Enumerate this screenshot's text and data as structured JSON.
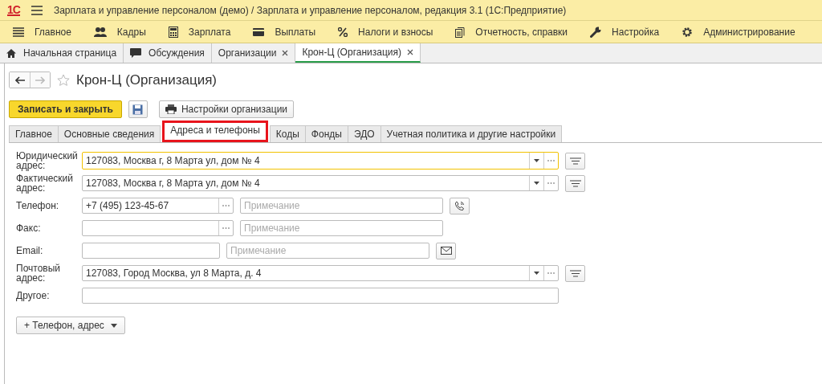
{
  "window": {
    "logo": "1С",
    "title": "Зарплата и управление персоналом (демо) / Зарплата и управление персоналом, редакция 3.1  (1С:Предприятие)"
  },
  "main_menu": [
    "Главное",
    "Кадры",
    "Зарплата",
    "Выплаты",
    "Налоги и взносы",
    "Отчетность, справки",
    "Настройка",
    "Администрирование"
  ],
  "open_tabs": [
    {
      "label": "Начальная страница",
      "selected": false,
      "closable": false,
      "kind": "home"
    },
    {
      "label": "Обсуждения",
      "selected": false,
      "closable": false,
      "kind": "chat"
    },
    {
      "label": "Организации",
      "selected": false,
      "closable": true,
      "kind": "plain"
    },
    {
      "label": "Крон-Ц (Организация)",
      "selected": true,
      "closable": true,
      "kind": "plain"
    }
  ],
  "form": {
    "title": "Крон-Ц (Организация)",
    "favorite": false,
    "buttons": {
      "primary": "Записать и закрыть",
      "settings": "Настройки организации"
    },
    "tabs": [
      {
        "label": "Главное",
        "selected": false,
        "highlighted": false
      },
      {
        "label": "Основные сведения",
        "selected": false,
        "highlighted": false
      },
      {
        "label": "Адреса и телефоны",
        "selected": true,
        "highlighted": true
      },
      {
        "label": "Коды",
        "selected": false,
        "highlighted": false
      },
      {
        "label": "Фонды",
        "selected": false,
        "highlighted": false
      },
      {
        "label": "ЭДО",
        "selected": false,
        "highlighted": false
      },
      {
        "label": "Учетная политика и другие настройки",
        "selected": false,
        "highlighted": false
      }
    ],
    "rows": [
      {
        "kind": "address",
        "label": "Юридический адрес:",
        "value": "127083, Москва г, 8 Марта ул, дом № 4",
        "focused": true
      },
      {
        "kind": "address",
        "label": "Фактический адрес:",
        "value": "127083, Москва г, 8 Марта ул, дом № 4",
        "focused": false
      },
      {
        "kind": "phone",
        "label": "Телефон:",
        "value": "+7 (495) 123-45-67",
        "placeholder": "Примечание"
      },
      {
        "kind": "fax",
        "label": "Факс:",
        "placeholder": "Примечание"
      },
      {
        "kind": "email",
        "label": "Email:",
        "placeholder": "Примечание"
      },
      {
        "kind": "address",
        "label": "Почтовый адрес:",
        "value": "127083, Город Москва, ул 8 Марта, д. 4",
        "focused": false
      },
      {
        "kind": "other",
        "label": "Другое:"
      }
    ],
    "add_button": "+ Телефон, адрес"
  }
}
